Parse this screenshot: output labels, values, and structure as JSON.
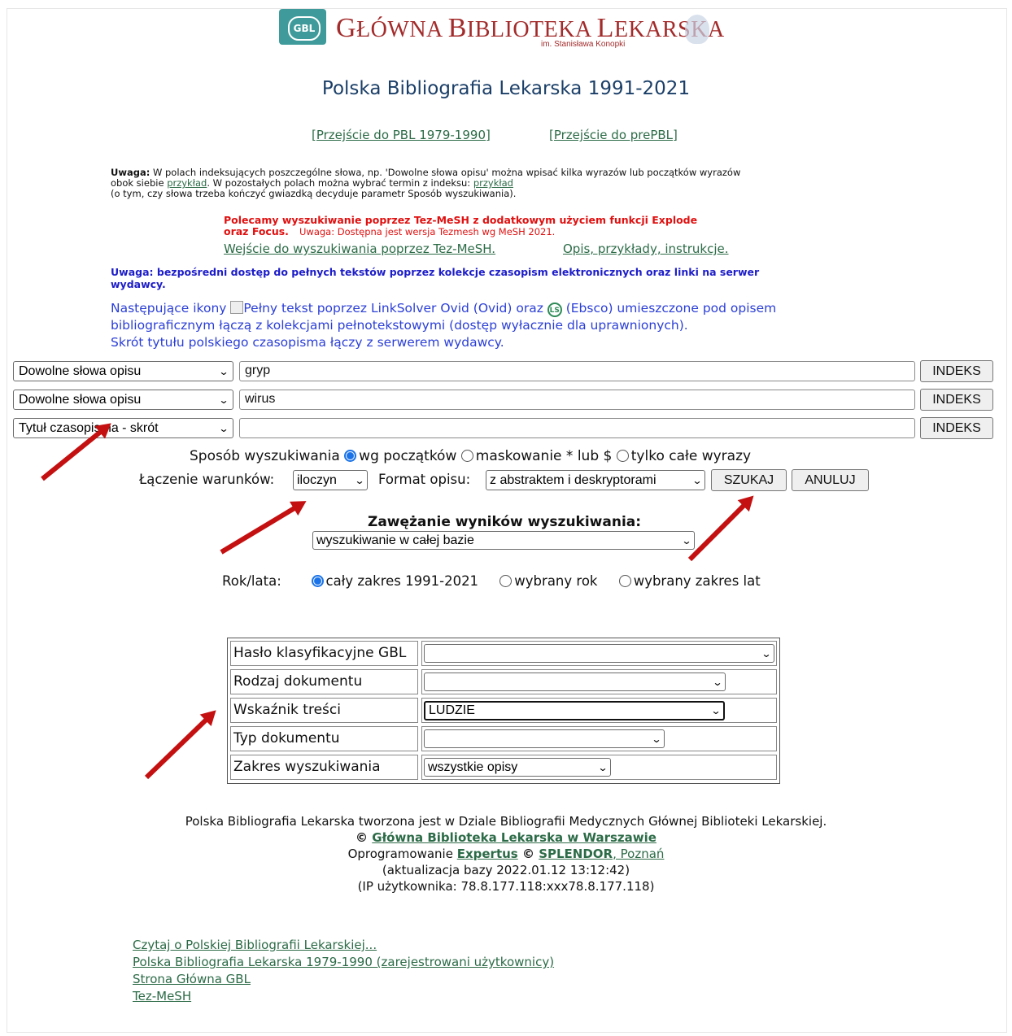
{
  "header": {
    "logo_mark": "GBL",
    "brand_prefix_1": "G",
    "brand_rest_1": "ŁÓWNA ",
    "brand_prefix_2": "B",
    "brand_rest_2": "IBLIOTEKA ",
    "brand_prefix_3": "L",
    "brand_rest_3": "EKARSKA",
    "brand_sub": "im. Stanisława Konopki",
    "title": "Polska Bibliografia Lekarska 1991-2021",
    "link_pbl_old": "[Przejście do PBL 1979-1990]",
    "link_prepbl": "[Przejście do prePBL]"
  },
  "notes": {
    "uwaga_label": "Uwaga:",
    "uwaga_text_1": " W polach indeksujących poszczególne słowa, np. 'Dowolne słowa opisu' można wpisać kilka wyrazów lub początków wyrazów",
    "uwaga_text_2a": "obok siebie ",
    "przyklad_1": "przykład",
    "uwaga_text_2b": ". W pozostałych polach można wybrać termin z indeksu: ",
    "przyklad_2": "przykład",
    "uwaga_text_3": "(o tym, czy słowa trzeba kończyć gwiazdką decyduje parametr Sposób wyszukiwania).",
    "red_1": "Polecamy wyszukiwanie poprzez Tez-MeSH z dodatkowym użyciem funkcji Explode",
    "red_2": "oraz Focus.",
    "red_2b": "Uwaga: Dostępna jest wersja Tezmesh wg MeSH 2021.",
    "link_tezmesh": "Wejście do wyszukiwania poprzez Tez-MeSH.",
    "link_opis": "Opis, przykłady, instrukcje.",
    "blue_1": "Uwaga: bezpośredni dostęp do pełnych tekstów poprzez kolekcje czasopism elektronicznych oraz linki na serwer",
    "blue_2": "wydawcy.",
    "icons_1a": "Następujące ikony ",
    "icons_1b": "Pełny tekst poprzez LinkSolver Ovid (Ovid) oraz ",
    "icons_1c": " (Ebsco) umieszczone pod opisem",
    "icons_2": "bibliograficznym łączą z kolekcjami pełnotekstowymi (dostęp wyłacznie dla uprawnionych).",
    "icons_3": "Skrót tytułu polskiego czasopisma łączy z serwerem wydawcy."
  },
  "search_rows": [
    {
      "field": "Dowolne słowa opisu",
      "value": "gryp",
      "button": "INDEKS"
    },
    {
      "field": "Dowolne słowa opisu",
      "value": "wirus",
      "button": "INDEKS"
    },
    {
      "field": "Tytuł czasopisma - skrót",
      "value": "",
      "button": "INDEKS"
    }
  ],
  "options": {
    "mode_label": "Sposób wyszukiwania",
    "mode_1": "wg początków",
    "mode_2": "maskowanie * lub $",
    "mode_3": "tylko całe wyrazy",
    "join_label": "Łączenie warunków:",
    "join_value": "iloczyn",
    "format_label": "Format opisu:",
    "format_value": "z abstraktem i deskryptorami",
    "search_btn": "SZUKAJ",
    "cancel_btn": "ANULUJ",
    "narrow_label": "Zawężanie wyników wyszukiwania:",
    "narrow_value": "wyszukiwanie w całej bazie",
    "year_label": "Rok/lata:",
    "year_1": "cały zakres 1991-2021",
    "year_2": "wybrany rok",
    "year_3": "wybrany zakres lat"
  },
  "filters": [
    {
      "label": "Hasło klasyfikacyjne GBL",
      "value": ""
    },
    {
      "label": "Rodzaj dokumentu",
      "value": ""
    },
    {
      "label": "Wskaźnik treści",
      "value": "LUDZIE"
    },
    {
      "label": "Typ dokumentu",
      "value": ""
    },
    {
      "label": "Zakres wyszukiwania",
      "value": "wszystkie opisy"
    }
  ],
  "footer": {
    "line1": "Polska Bibliografia Lekarska tworzona jest w Dziale Bibliografii Medycznych Głównej Biblioteki Lekarskiej.",
    "copy": "© ",
    "gbl_link": "Główna Biblioteka Lekarska w Warszawie",
    "soft": "Oprogramowanie ",
    "expertus": "Expertus",
    "copy2": " © ",
    "splendor": "SPLENDOR",
    "poznan": ", Poznań",
    "update": "(aktualizacja bazy 2022.01.12 13:12:42)",
    "ip": "(IP użytkownika: 78.8.177.118:xxx78.8.177.118)"
  },
  "bottom_links": [
    "Czytaj o Polskiej Bibliografii Lekarskiej...",
    "Polska Bibliografia Lekarska 1979-1990 (zarejestrowani użytkownicy)",
    "Strona Główna GBL",
    "Tez-MeSH"
  ],
  "colors": {
    "annotation_arrow": "#c41010",
    "radio_selected": "#1a73e8",
    "link": "#2c6b47",
    "title": "#1b3f68"
  }
}
